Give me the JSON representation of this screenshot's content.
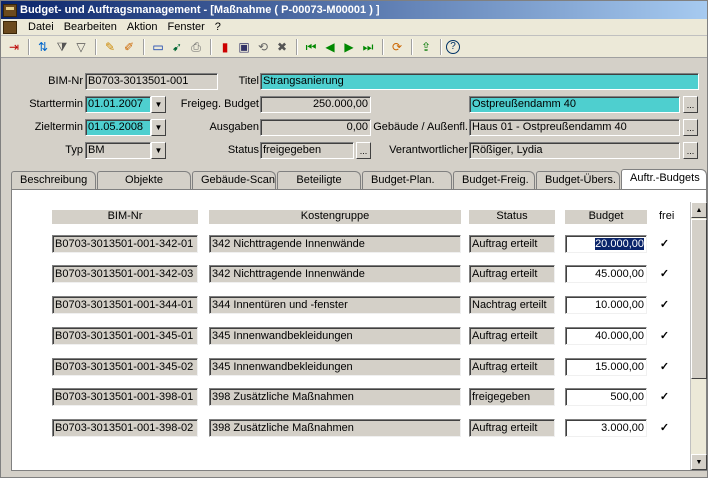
{
  "window": {
    "title": "Budget- und Auftragsmanagement - [Maßnahme ( P-00073-M00001 ) ]"
  },
  "menu": [
    "Datei",
    "Bearbeiten",
    "Aktion",
    "Fenster",
    "?"
  ],
  "toolbar_icons": [
    "exit-icon",
    "sort-icon",
    "filter-multi-icon",
    "filter-icon",
    "edit-icon",
    "edit-find-icon",
    "window-icon",
    "pin-icon",
    "print-icon",
    "red-book-icon",
    "save-icon",
    "undo-icon",
    "delete-icon",
    "first-record-icon",
    "prev-record-icon",
    "next-record-icon",
    "last-record-icon",
    "sync-icon",
    "export-icon",
    "help-icon"
  ],
  "form": {
    "bim_nr_label": "BIM-Nr",
    "bim_nr": "B0703-3013501-001",
    "titel_label": "Titel",
    "titel": "Strangsanierung",
    "starttermin_label": "Starttermin",
    "starttermin": "01.01.2007",
    "freig_budget_label": "Freigeg. Budget",
    "freig_budget": "250.000,00",
    "address": "Ostpreußendamm 40",
    "zieltermin_label": "Zieltermin",
    "zieltermin": "01.05.2008",
    "ausgaben_label": "Ausgaben",
    "ausgaben": "0,00",
    "gebaeude_label": "Gebäude / Außenfl.",
    "gebaeude": "Haus 01 - Ostpreußendamm 40",
    "typ_label": "Typ",
    "typ": "BM",
    "status_label": "Status",
    "status": "freigegeben",
    "verantwortlicher_label": "Verantwortlicher",
    "verantwortlicher": "Rößiger, Lydia",
    "ellipsis": "..."
  },
  "tabs": [
    "Beschreibung",
    "Objekte",
    "Gebäude-Scan",
    "Beteiligte",
    "Budget-Plan.",
    "Budget-Freig.",
    "Budget-Übers.",
    "Auftr.-Budgets"
  ],
  "active_tab": "Auftr.-Budgets",
  "table": {
    "headers": {
      "bim_nr": "BIM-Nr",
      "kostengruppe": "Kostengruppe",
      "status": "Status",
      "budget": "Budget",
      "frei": "frei"
    },
    "rows": [
      {
        "bim_nr": "B0703-3013501-001-342-01",
        "kostengruppe": "342 Nichttragende Innenwände",
        "status": "Auftrag erteilt",
        "budget": "20.000,00",
        "frei": "✓"
      },
      {
        "bim_nr": "B0703-3013501-001-342-03",
        "kostengruppe": "342 Nichttragende Innenwände",
        "status": "Auftrag erteilt",
        "budget": "45.000,00",
        "frei": "✓"
      },
      {
        "bim_nr": "B0703-3013501-001-344-01",
        "kostengruppe": "344 Innentüren und -fenster",
        "status": "Nachtrag erteilt",
        "budget": "10.000,00",
        "frei": "✓"
      },
      {
        "bim_nr": "B0703-3013501-001-345-01",
        "kostengruppe": "345 Innenwandbekleidungen",
        "status": "Auftrag erteilt",
        "budget": "40.000,00",
        "frei": "✓"
      },
      {
        "bim_nr": "B0703-3013501-001-345-02",
        "kostengruppe": "345 Innenwandbekleidungen",
        "status": "Auftrag erteilt",
        "budget": "15.000,00",
        "frei": "✓"
      },
      {
        "bim_nr": "B0703-3013501-001-398-01",
        "kostengruppe": "398 Zusätzliche Maßnahmen",
        "status": "freigegeben",
        "budget": "500,00",
        "frei": "✓"
      },
      {
        "bim_nr": "B0703-3013501-001-398-02",
        "kostengruppe": "398 Zusätzliche Maßnahmen",
        "status": "Auftrag erteilt",
        "budget": "3.000,00",
        "frei": "✓"
      }
    ]
  }
}
